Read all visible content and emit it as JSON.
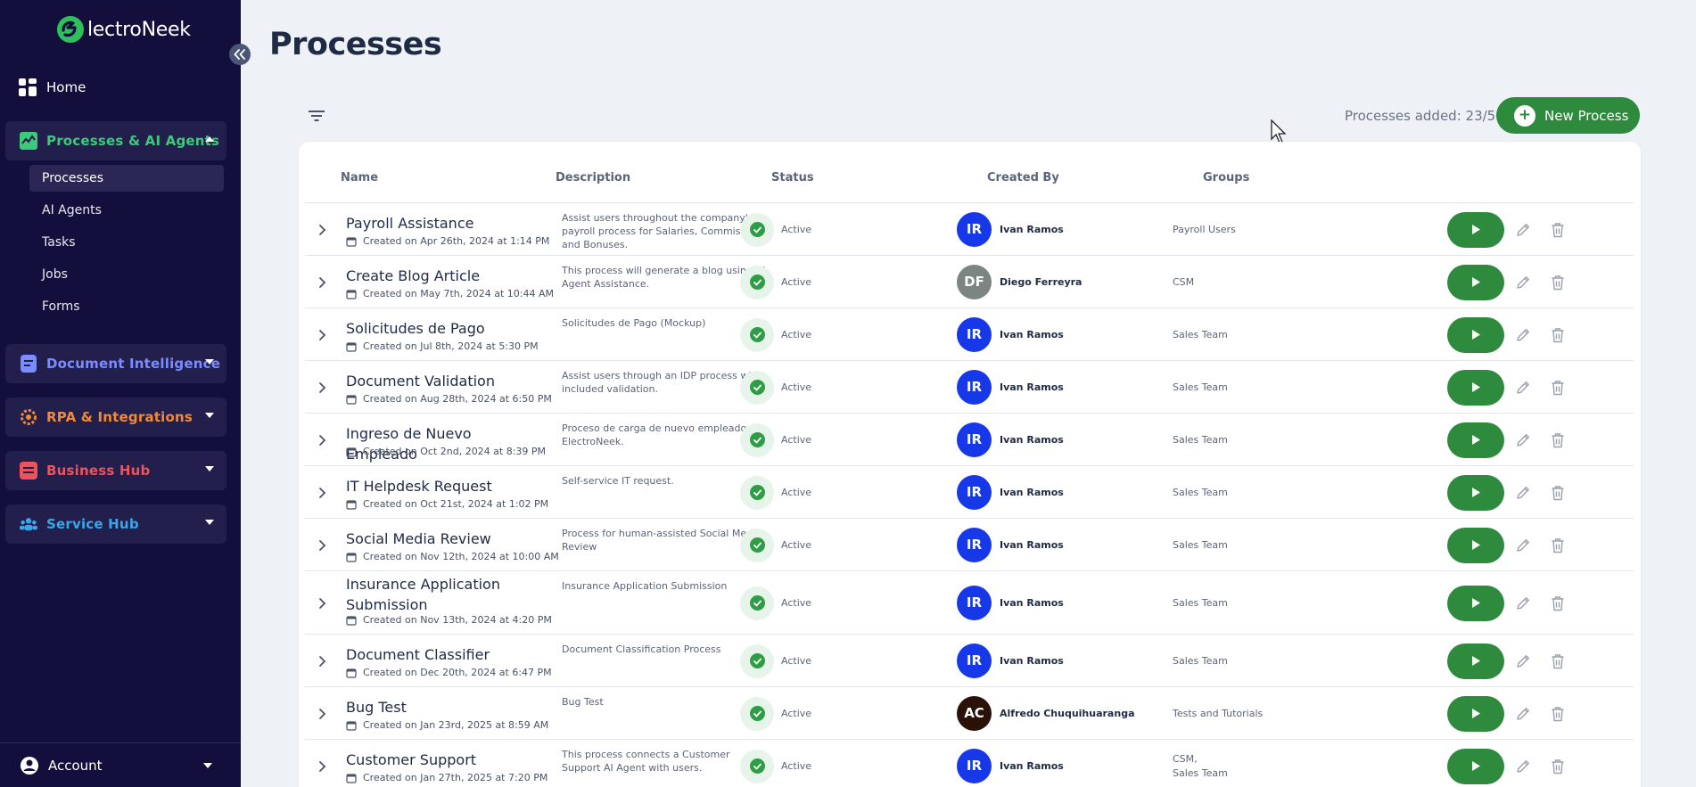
{
  "app": {
    "logo_text": "lectroNeek",
    "colors": {
      "sidebar_bg": "#130f3d",
      "accent_green": "#2e8b3d",
      "avatar_blue": "#1638e8"
    }
  },
  "sidebar": {
    "home": {
      "label": "Home",
      "icon": "grid-icon"
    },
    "sections": [
      {
        "label": "Processes & AI Agents",
        "color": "#3ec97a",
        "expanded": true,
        "icon": "processes-icon"
      },
      {
        "label": "Document Intelligence",
        "color": "#7b8cff",
        "expanded": false,
        "icon": "document-icon"
      },
      {
        "label": "RPA & Integrations",
        "color": "#f08a3a",
        "expanded": false,
        "icon": "gear-icon"
      },
      {
        "label": "Business Hub",
        "color": "#f0525a",
        "expanded": false,
        "icon": "business-icon"
      },
      {
        "label": "Service Hub",
        "color": "#3aa6e8",
        "expanded": false,
        "icon": "people-icon"
      }
    ],
    "sub_items": [
      {
        "label": "Processes",
        "active": true
      },
      {
        "label": "AI Agents",
        "active": false
      },
      {
        "label": "Tasks",
        "active": false
      },
      {
        "label": "Jobs",
        "active": false
      },
      {
        "label": "Forms",
        "active": false
      }
    ],
    "account": {
      "label": "Account",
      "icon": "user-icon"
    }
  },
  "main": {
    "title": "Processes",
    "processes_added": "Processes added: 23/50",
    "new_process_label": "New Process"
  },
  "table": {
    "columns": [
      "Name",
      "Description",
      "Status",
      "Created By",
      "Groups"
    ],
    "rows": [
      {
        "name": "Payroll Assistance",
        "created": "Created on Apr 26th, 2024 at 1:14 PM",
        "description": "Assist users throughout the company's payroll process for Salaries, Commissions and Bonuses.",
        "status": "Active",
        "initials": "IR",
        "creator": "Ivan Ramos",
        "avatar_color": "#1638e8",
        "groups": "Payroll Users"
      },
      {
        "name": "Create Blog Article",
        "created": "Created on May 7th, 2024 at 10:44 AM",
        "description": "This process will generate a blog using AI Agent Assistance.",
        "status": "Active",
        "initials": "DF",
        "creator": "Diego Ferreyra",
        "avatar_color": "#7c8582",
        "groups": "CSM"
      },
      {
        "name": "Solicitudes de Pago",
        "created": "Created on Jul 8th, 2024 at 5:30 PM",
        "description": "Solicitudes de Pago (Mockup)",
        "status": "Active",
        "initials": "IR",
        "creator": "Ivan Ramos",
        "avatar_color": "#1638e8",
        "groups": "Sales Team"
      },
      {
        "name": "Document Validation",
        "created": "Created on Aug 28th, 2024 at 6:50 PM",
        "description": "Assist users through an IDP process with included validation.",
        "status": "Active",
        "initials": "IR",
        "creator": "Ivan Ramos",
        "avatar_color": "#1638e8",
        "groups": "Sales Team"
      },
      {
        "name": "Ingreso de Nuevo Empleado",
        "created": "Created on Oct 2nd, 2024 at 8:39 PM",
        "description": "Proceso de carga de nuevo empleado en ElectroNeek.",
        "status": "Active",
        "initials": "IR",
        "creator": "Ivan Ramos",
        "avatar_color": "#1638e8",
        "groups": "Sales Team"
      },
      {
        "name": "IT Helpdesk Request",
        "created": "Created on Oct 21st, 2024 at 1:02 PM",
        "description": "Self-service IT request.",
        "status": "Active",
        "initials": "IR",
        "creator": "Ivan Ramos",
        "avatar_color": "#1638e8",
        "groups": "Sales Team"
      },
      {
        "name": "Social Media Review",
        "created": "Created on Nov 12th, 2024 at 10:00 AM",
        "description": "Process for human-assisted Social Media Review",
        "status": "Active",
        "initials": "IR",
        "creator": "Ivan Ramos",
        "avatar_color": "#1638e8",
        "groups": "Sales Team"
      },
      {
        "name": "Insurance Application Submission",
        "created": "Created on Nov 13th, 2024 at 4:20 PM",
        "description": "Insurance Application Submission",
        "status": "Active",
        "initials": "IR",
        "creator": "Ivan Ramos",
        "avatar_color": "#1638e8",
        "groups": "Sales Team"
      },
      {
        "name": "Document Classifier",
        "created": "Created on Dec 20th, 2024 at 6:47 PM",
        "description": "Document Classification Process",
        "status": "Active",
        "initials": "IR",
        "creator": "Ivan Ramos",
        "avatar_color": "#1638e8",
        "groups": "Sales Team"
      },
      {
        "name": "Bug Test",
        "created": "Created on Jan 23rd, 2025 at 8:59 AM",
        "description": "Bug Test",
        "status": "Active",
        "initials": "AC",
        "creator": "Alfredo Chuquihuaranga",
        "avatar_color": "#2a1208",
        "groups": "Tests and Tutorials"
      },
      {
        "name": "Customer Support",
        "created": "Created on Jan 27th, 2025 at 7:20 PM",
        "description": "This process connects a Customer Support AI Agent with users.",
        "status": "Active",
        "initials": "IR",
        "creator": "Ivan Ramos",
        "avatar_color": "#1638e8",
        "groups": "CSM,\nSales Team"
      }
    ]
  }
}
